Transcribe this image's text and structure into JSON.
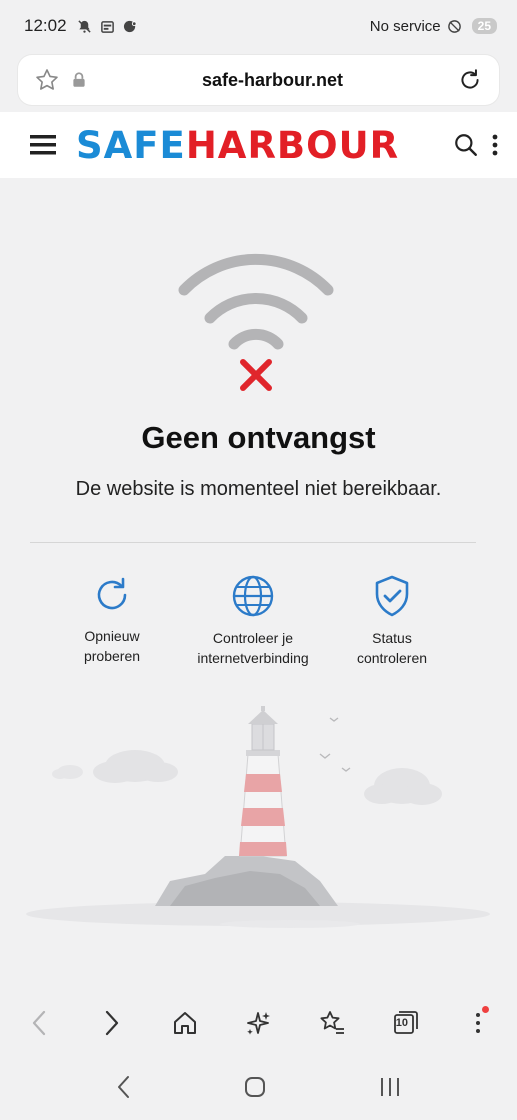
{
  "status_bar": {
    "time": "12:02",
    "carrier": "No service",
    "battery": "25"
  },
  "browser": {
    "url": "safe-harbour.net"
  },
  "site": {
    "logo_part1": "SAFE",
    "logo_part2": "HARBOUR"
  },
  "error": {
    "title": "Geen ontvangst",
    "message": "De website is momenteel niet bereikbaar."
  },
  "actions": [
    {
      "line1": "Opnieuw",
      "line2": "proberen",
      "icon": "refresh-icon"
    },
    {
      "line1": "Controleer je",
      "line2": "internetverbinding",
      "icon": "globe-icon"
    },
    {
      "line1": "Status",
      "line2": "controleren",
      "icon": "shield-check-icon"
    }
  ],
  "bottom_nav": {
    "tabs_count": "10"
  },
  "colors": {
    "accent_blue": "#1b8bd6",
    "brand_red": "#e21f26",
    "error_x": "#e0262c"
  }
}
